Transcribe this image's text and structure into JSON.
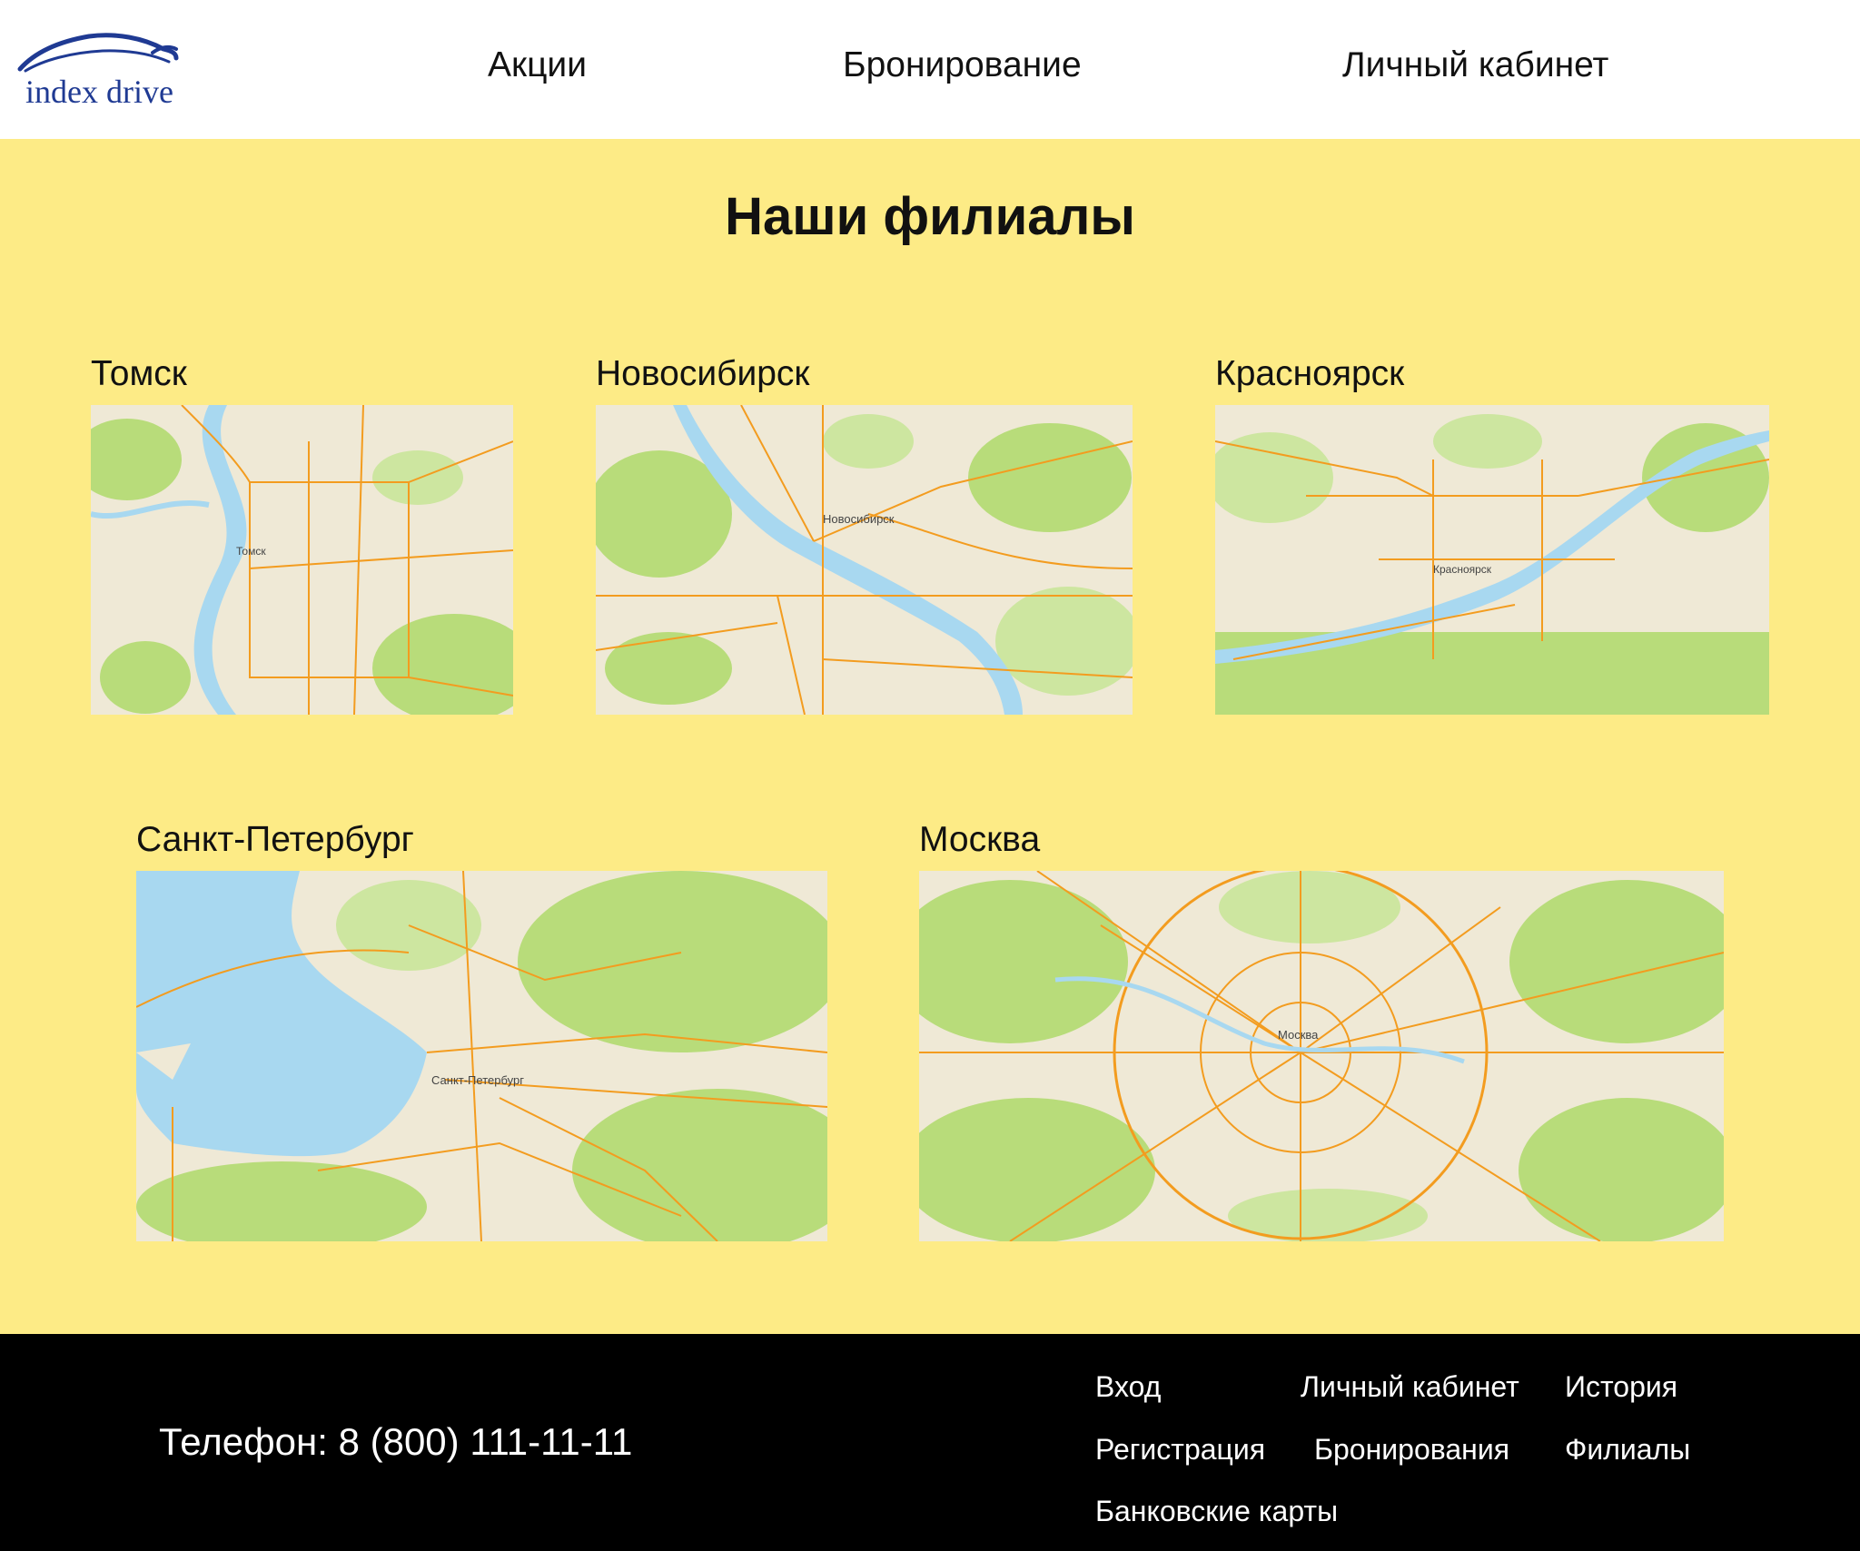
{
  "header": {
    "logo_text": "index drive",
    "nav": [
      "Акции",
      "Бронирование",
      "Личный кабинет"
    ]
  },
  "main": {
    "title": "Наши филиалы",
    "cities": [
      {
        "name": "Томск",
        "map_label": "Томск"
      },
      {
        "name": "Новосибирск",
        "map_label": "Новосибирск"
      },
      {
        "name": "Красноярск",
        "map_label": "Красноярск"
      },
      {
        "name": "Санкт-Петербург",
        "map_label": "Санкт-Петербург"
      },
      {
        "name": "Москва",
        "map_label": "Москва"
      }
    ]
  },
  "footer": {
    "phone": "Телефон: 8 (800) 111-11-11",
    "links": [
      "Вход",
      "Личный кабинет",
      "История",
      "Регистрация",
      "Бронирования",
      "Филиалы",
      "Банковские карты"
    ]
  },
  "colors": {
    "accent_background": "#fdeb86",
    "footer": "#000000",
    "map_water": "#a8d8f0",
    "map_green": "#b8dc7a",
    "map_road": "#f39c1f"
  }
}
